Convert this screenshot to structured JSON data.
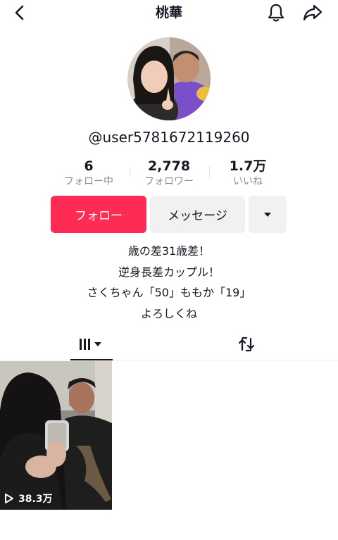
{
  "header": {
    "title": "桃華",
    "back_icon": "chevron-left-icon",
    "bell_icon": "bell-icon",
    "share_icon": "share-arrow-icon"
  },
  "profile": {
    "username": "@user5781672119260",
    "stats": [
      {
        "value": "6",
        "label": "フォロー中"
      },
      {
        "value": "2,778",
        "label": "フォロワー"
      },
      {
        "value": "1.7万",
        "label": "いいね"
      }
    ]
  },
  "actions": {
    "follow_label": "フォロー",
    "message_label": "メッセージ",
    "more_icon": "caret-down-icon"
  },
  "bio": {
    "lines": [
      "歳の差31歳差！",
      "逆身長差カップル！",
      "さくちゃん「50」ももか「19」",
      "よろしくね"
    ]
  },
  "tabs": {
    "videos_icon": "video-grid-icon",
    "reposts_icon": "repost-icon"
  },
  "videos": [
    {
      "views": "38.3万"
    }
  ],
  "colors": {
    "accent": "#fe2c55",
    "secondary_button": "#f1f1f2",
    "muted_text": "#8a8b91"
  }
}
